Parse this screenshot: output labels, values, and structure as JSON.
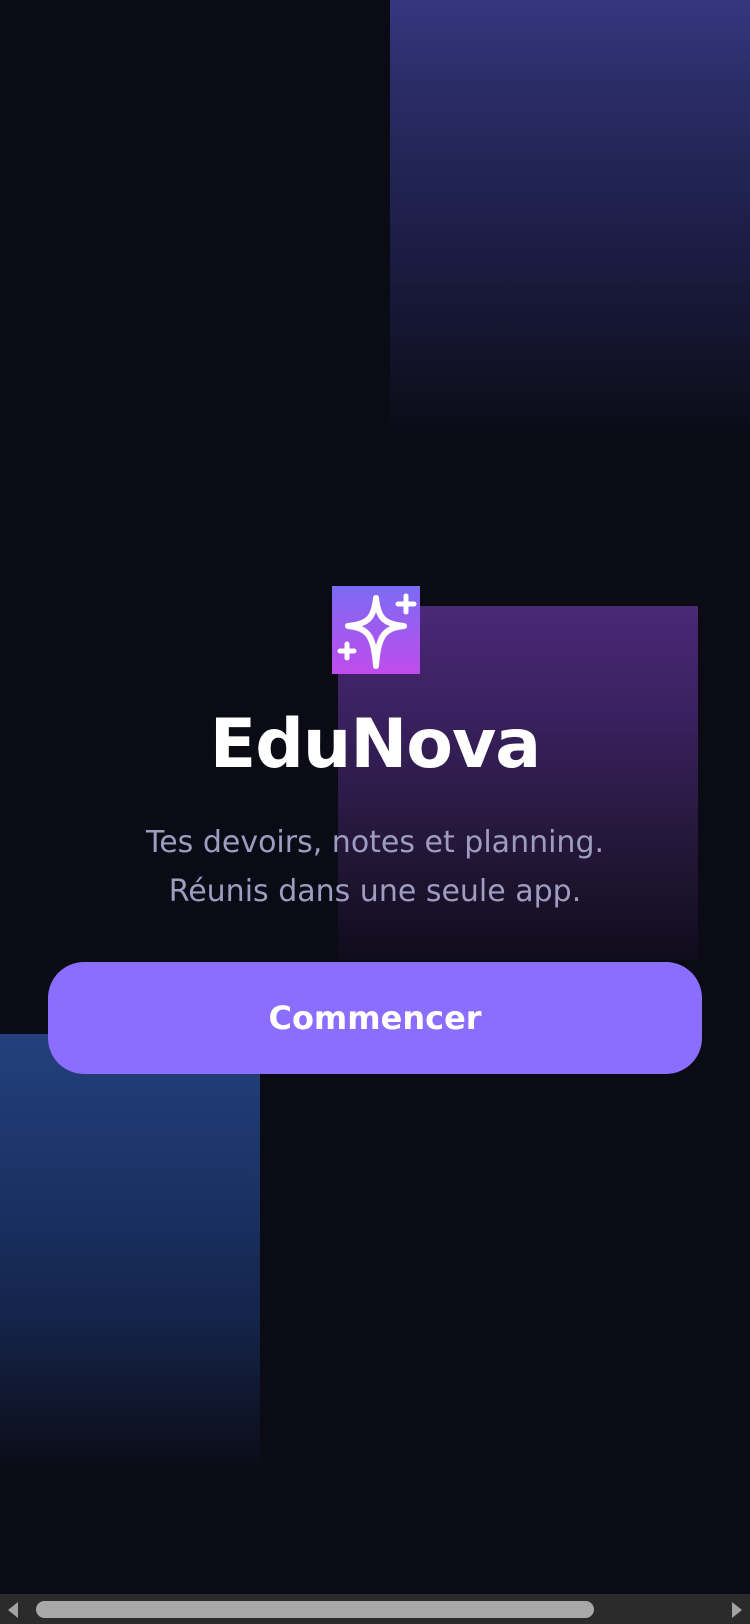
{
  "app": {
    "name": "EduNova",
    "logo_icon": "sparkle-icon"
  },
  "hero": {
    "tagline_line1": "Tes devoirs, notes et planning.",
    "tagline_line2": "Réunis dans une seule app."
  },
  "actions": {
    "start_label": "Commencer"
  },
  "colors": {
    "background": "#0b0b15",
    "accent": "#8b6dff",
    "logo_gradient_top": "#7b6bf4",
    "logo_gradient_bottom": "#c04cec",
    "tagline": "#9e9cc0"
  }
}
